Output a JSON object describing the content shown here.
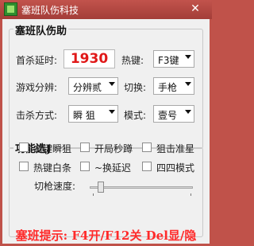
{
  "window": {
    "title": "塞班队伤科技",
    "close_glyph": "✕"
  },
  "main_group": {
    "title": "塞班队伤助",
    "delay_label": "首杀延时:",
    "delay_value": "1930",
    "hotkey_label": "热键:",
    "hotkey_value": "F3键",
    "resolution_label": "游戏分辨:",
    "resolution_value": "分辨贰",
    "switch_label": "切换:",
    "switch_value": "手枪",
    "kill_mode_label": "击杀方式:",
    "kill_mode_value": "瞬 狙",
    "mode_label": "模式:",
    "mode_value": "壹号"
  },
  "features_group": {
    "title": "功能选J",
    "options": [
      {
        "label": "右键瞬狙",
        "checked": false
      },
      {
        "label": "开局秒蹲",
        "checked": false
      },
      {
        "label": "狙击准星",
        "checked": false
      },
      {
        "label": "热键白条",
        "checked": false
      },
      {
        "label": "~换延迟",
        "checked": false
      },
      {
        "label": "四四模式",
        "checked": false
      }
    ],
    "speed_label": "切枪速度:",
    "speed_level": 0.08
  },
  "footer": {
    "hint": "塞班提示: F4开/F12关 Del显/隐"
  },
  "colors": {
    "title_bar": "#b2443e",
    "accent_red": "#e01818",
    "footer_red": "#ff2a2a"
  }
}
